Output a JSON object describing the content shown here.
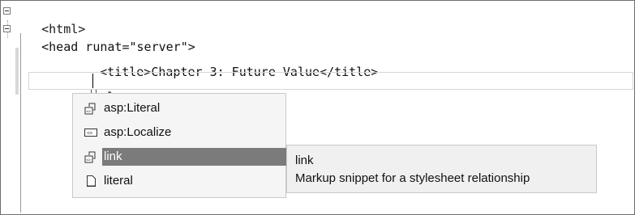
{
  "editor": {
    "lines": [
      {
        "text": "<html>"
      },
      {
        "text": "<head runat=\"server\">"
      },
      {
        "text": "<title>Chapter 3: Future Value</title>"
      },
      {
        "text": "<l"
      }
    ]
  },
  "completion": {
    "items": [
      {
        "label": "asp:Literal",
        "icon": "control-snippet-icon"
      },
      {
        "label": "asp:Localize",
        "icon": "control-icon"
      },
      {
        "label": "link",
        "icon": "control-snippet-icon",
        "selected": true
      },
      {
        "label": "literal",
        "icon": "snippet-page-icon"
      }
    ]
  },
  "tooltip": {
    "title": "link",
    "description": "Markup snippet for a stylesheet relationship"
  }
}
